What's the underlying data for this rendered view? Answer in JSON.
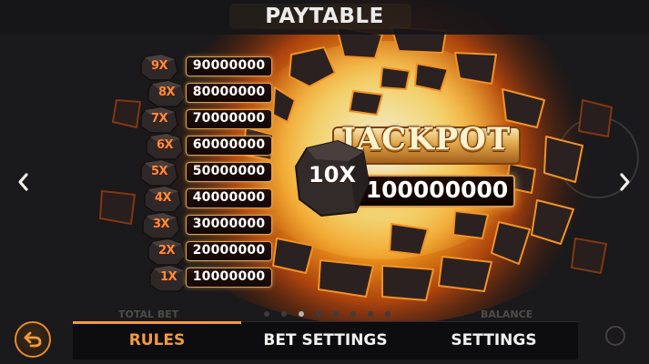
{
  "header": {
    "title": "PAYTABLE"
  },
  "paytable": [
    {
      "multiplier": "9X",
      "amount": "90000000"
    },
    {
      "multiplier": "8X",
      "amount": "80000000"
    },
    {
      "multiplier": "7X",
      "amount": "70000000"
    },
    {
      "multiplier": "6X",
      "amount": "60000000"
    },
    {
      "multiplier": "5X",
      "amount": "50000000"
    },
    {
      "multiplier": "4X",
      "amount": "40000000"
    },
    {
      "multiplier": "3X",
      "amount": "30000000"
    },
    {
      "multiplier": "2X",
      "amount": "20000000"
    },
    {
      "multiplier": "1X",
      "amount": "10000000"
    }
  ],
  "jackpot": {
    "label": "JACKPOT",
    "multiplier": "10X",
    "amount": "100000000"
  },
  "background": {
    "total_bet_label": "TOTAL BET",
    "balance_label": "BALANCE"
  },
  "pagination": {
    "pages": 8,
    "current": 3
  },
  "tabs": [
    {
      "label": "RULES",
      "active": true
    },
    {
      "label": "BET SETTINGS",
      "active": false
    },
    {
      "label": "SETTINGS",
      "active": false
    }
  ],
  "icons": {
    "prev": "chevron-left-icon",
    "next": "chevron-right-icon",
    "back": "undo-arrow-icon"
  },
  "colors": {
    "accent": "#f39a3c",
    "multiplier_text": "#ff8a3d",
    "amount_border": "#d9a45a",
    "background": "#1b1a1c"
  }
}
